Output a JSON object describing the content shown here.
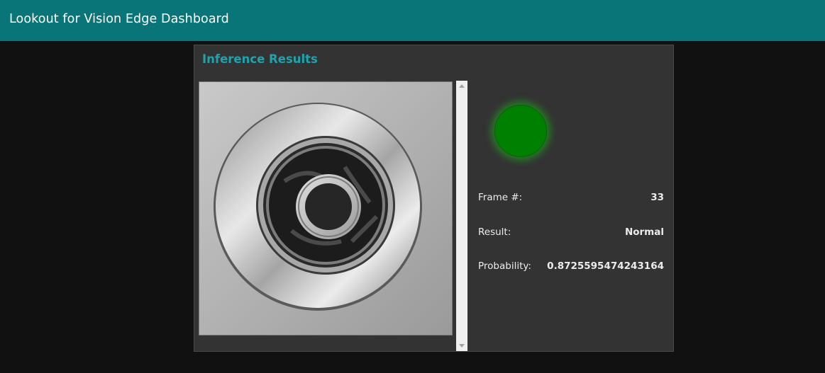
{
  "header": {
    "title": "Lookout for Vision Edge Dashboard"
  },
  "panel": {
    "title": "Inference Results",
    "image_subject": "inspected machined part (grayscale)",
    "status_light": {
      "state": "normal",
      "color": "#008000"
    },
    "fields": {
      "frame_label": "Frame #:",
      "frame_value": "33",
      "result_label": "Result:",
      "result_value": "Normal",
      "probability_label": "Probability:",
      "probability_value": "0.8725595474243164"
    }
  },
  "colors": {
    "header_bg": "#097578",
    "accent": "#1fa3ad",
    "page_bg": "#111111",
    "panel_bg": "#333333"
  },
  "icons": {
    "scroll_up": "scroll-up-arrow-icon",
    "scroll_down": "scroll-down-arrow-icon"
  }
}
